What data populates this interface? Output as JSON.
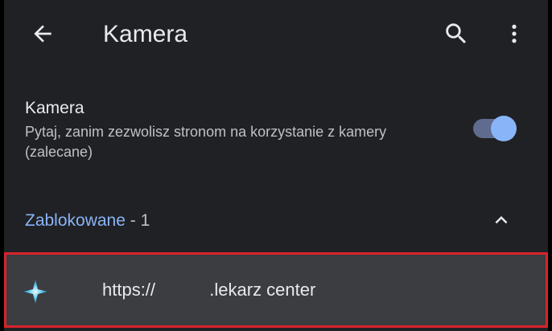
{
  "app_bar": {
    "title": "Kamera",
    "back_icon": "arrow-left-icon",
    "search_icon": "search-icon",
    "menu_icon": "more-vert-icon"
  },
  "setting": {
    "title": "Kamera",
    "description": "Pytaj, zanim zezwolisz stronom na korzystanie z kamery (zalecane)",
    "toggle_on": true
  },
  "blocked_section": {
    "name": "Zablokowane",
    "count": " - 1",
    "expanded": true,
    "collapse_icon": "chevron-up-icon"
  },
  "blocked_sites": [
    {
      "url": "https://           .lekarz center",
      "favicon": "cross-favicon-icon"
    }
  ],
  "colors": {
    "background": "#202124",
    "accent": "#8ab4f8",
    "highlight_border": "#d8232a",
    "row_selected": "#3c3d41"
  }
}
